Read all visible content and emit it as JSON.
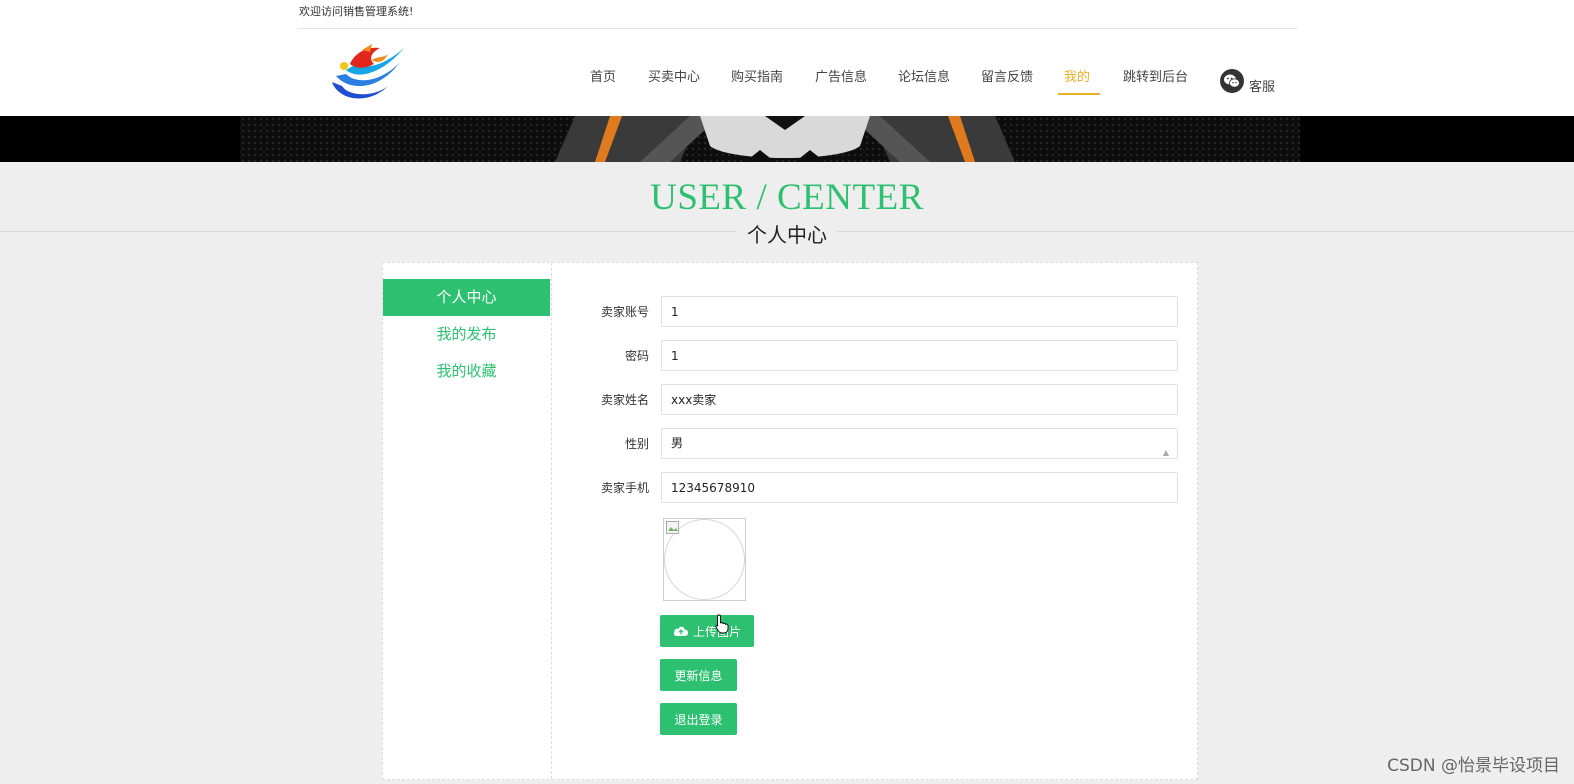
{
  "header": {
    "welcome_text": "欢迎访问销售管理系统!",
    "nav": [
      {
        "label": "首页",
        "active": false
      },
      {
        "label": "买卖中心",
        "active": false
      },
      {
        "label": "购买指南",
        "active": false
      },
      {
        "label": "广告信息",
        "active": false
      },
      {
        "label": "论坛信息",
        "active": false
      },
      {
        "label": "留言反馈",
        "active": false
      },
      {
        "label": "我的",
        "active": true
      },
      {
        "label": "跳转到后台",
        "active": false
      }
    ],
    "service_label": "客服"
  },
  "page_title": {
    "en": "USER / CENTER",
    "cn": "个人中心"
  },
  "sidebar": {
    "items": [
      {
        "label": "个人中心",
        "active": true
      },
      {
        "label": "我的发布",
        "active": false
      },
      {
        "label": "我的收藏",
        "active": false
      }
    ]
  },
  "form": {
    "account": {
      "label": "卖家账号",
      "value": "1"
    },
    "password": {
      "label": "密码",
      "value": "1"
    },
    "name": {
      "label": "卖家姓名",
      "value": "xxx卖家"
    },
    "gender": {
      "label": "性别",
      "value": "男"
    },
    "phone": {
      "label": "卖家手机",
      "value": "12345678910"
    }
  },
  "buttons": {
    "upload": "上传图片",
    "update": "更新信息",
    "logout": "退出登录"
  },
  "watermark": "CSDN @怡景毕设项目",
  "colors": {
    "accent": "#2ec071",
    "nav_active": "#e8b128"
  }
}
